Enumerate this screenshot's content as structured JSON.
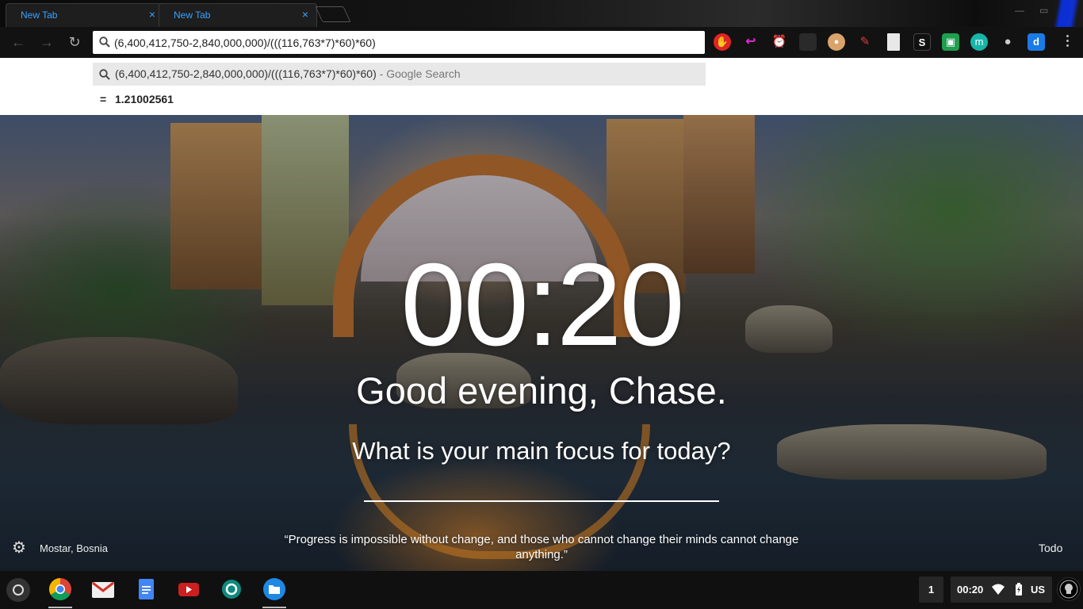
{
  "browser": {
    "tabs": [
      {
        "title": "New Tab",
        "close": "×"
      },
      {
        "title": "New Tab",
        "close": "×"
      }
    ],
    "omnibox": {
      "value": "(6,400,412,750-2,840,000,000)/(((116,763*7)*60)*60)"
    },
    "suggestion": {
      "query": "(6,400,412,750-2,840,000,000)/(((116,763*7)*60)*60)",
      "suffix": " - Google Search"
    },
    "calculator": {
      "equals": "=",
      "answer": "1.21002561"
    },
    "extensions": [
      "stop-sign-icon",
      "arrow-icon",
      "alarm-icon",
      "dark-square-icon",
      "palette-icon",
      "pen-icon",
      "document-icon",
      "s-icon",
      "classroom-icon",
      "m-icon",
      "lightbulb-icon",
      "d-icon"
    ],
    "colors": {
      "accent_tab": "#3aa3ff",
      "extension_s": "S",
      "extension_m": "m",
      "extension_d": "d"
    }
  },
  "momentum": {
    "time": "00:20",
    "greeting": "Good evening, Chase.",
    "focus_question": "What is your main focus for today?",
    "location": "Mostar, Bosnia",
    "quote": "“Progress is impossible without change, and those who cannot change their minds cannot change anything.”",
    "todo": "Todo"
  },
  "shelf": {
    "apps": [
      "chrome-icon",
      "gmail-icon",
      "docs-icon",
      "youtube-icon",
      "camera-icon",
      "files-icon"
    ],
    "workspace": "1",
    "time": "00:20",
    "ime": "US"
  }
}
